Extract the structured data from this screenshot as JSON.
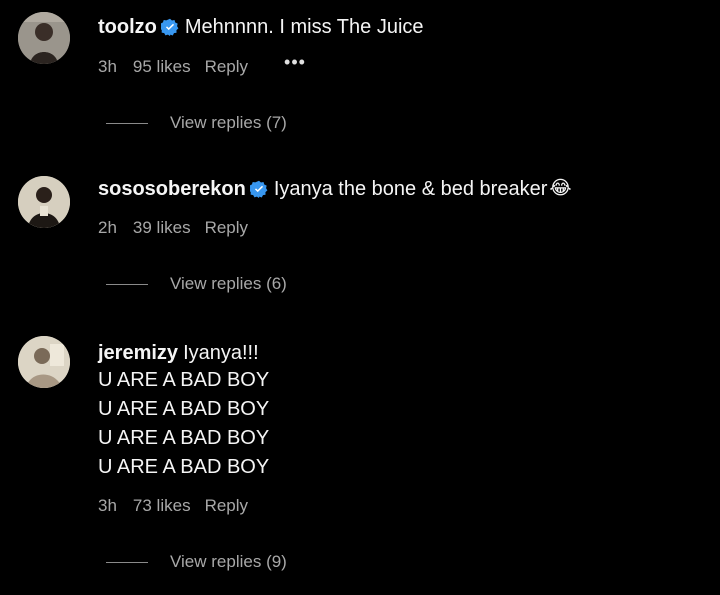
{
  "comments": [
    {
      "username": "toolzo",
      "verified": true,
      "text": "Mehnnnn. I miss The Juice",
      "extra_lines": [],
      "time": "3h",
      "likes": "95 likes",
      "reply": "Reply",
      "more": "•••",
      "view_replies": "View replies (7)"
    },
    {
      "username": "sososoberekon",
      "verified": true,
      "text": "Iyanya the bone & bed breaker",
      "emoji": "😂",
      "extra_lines": [],
      "time": "2h",
      "likes": "39 likes",
      "reply": "Reply",
      "view_replies": "View replies (6)"
    },
    {
      "username": "jeremizy",
      "verified": false,
      "text": "Iyanya!!!",
      "extra_lines": [
        "U ARE A BAD BOY",
        "U ARE A BAD BOY",
        "U ARE A BAD BOY",
        "U ARE A BAD BOY"
      ],
      "time": "3h",
      "likes": "73 likes",
      "reply": "Reply",
      "view_replies": "View replies (9)"
    }
  ],
  "colors": {
    "background": "#000000",
    "primary_text": "#f5f5f5",
    "secondary_text": "#a8a8a8",
    "verified_badge": "#3897f0"
  }
}
